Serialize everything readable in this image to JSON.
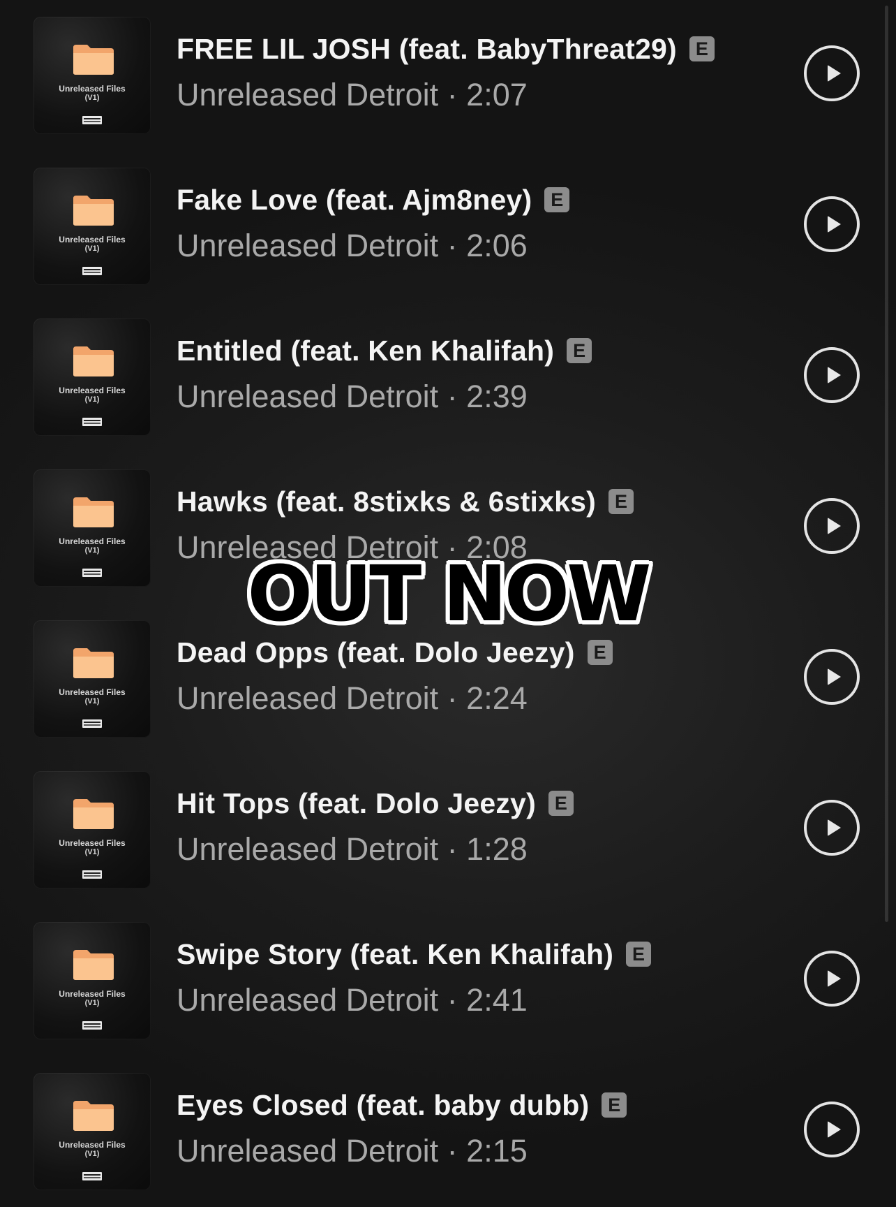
{
  "cover_art": {
    "title": "Unreleased Files",
    "version": "(V1)"
  },
  "explicit_badge": "E",
  "overlay": {
    "text": "OUT NOW"
  },
  "tracks": [
    {
      "title": "FREE LIL JOSH (feat. BabyThreat29)",
      "subtitle": "Unreleased Detroit · 2:07"
    },
    {
      "title": "Fake Love (feat. Ajm8ney)",
      "subtitle": "Unreleased Detroit · 2:06"
    },
    {
      "title": "Entitled (feat. Ken Khalifah)",
      "subtitle": "Unreleased Detroit · 2:39"
    },
    {
      "title": "Hawks (feat. 8stixks & 6stixks)",
      "subtitle": "Unreleased Detroit · 2:08"
    },
    {
      "title": "Dead Opps (feat. Dolo Jeezy)",
      "subtitle": "Unreleased Detroit · 2:24"
    },
    {
      "title": "Hit Tops (feat. Dolo Jeezy)",
      "subtitle": "Unreleased Detroit · 1:28"
    },
    {
      "title": "Swipe Story (feat. Ken Khalifah)",
      "subtitle": "Unreleased Detroit · 2:41"
    },
    {
      "title": "Eyes Closed (feat. baby dubb)",
      "subtitle": "Unreleased Detroit · 2:15"
    }
  ]
}
